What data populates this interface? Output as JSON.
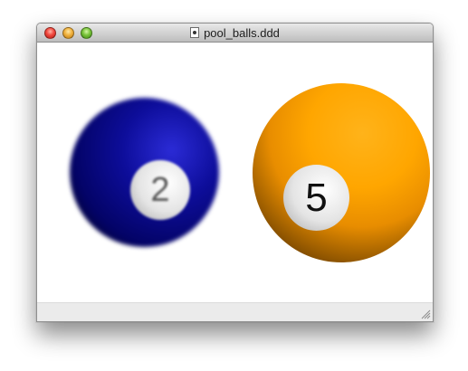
{
  "window": {
    "title": "pool_balls.ddd",
    "title_icon": "document-icon",
    "controls": {
      "close_icon": "close-icon",
      "minimize_icon": "minimize-icon",
      "zoom_icon": "zoom-icon"
    }
  },
  "content": {
    "balls": [
      {
        "number": "2",
        "color": "#0a0a9a",
        "state": "blurred"
      },
      {
        "number": "5",
        "color": "#ffa600",
        "state": "sharp"
      }
    ]
  },
  "statusbar": {
    "resize_icon": "resize-grip-icon"
  }
}
